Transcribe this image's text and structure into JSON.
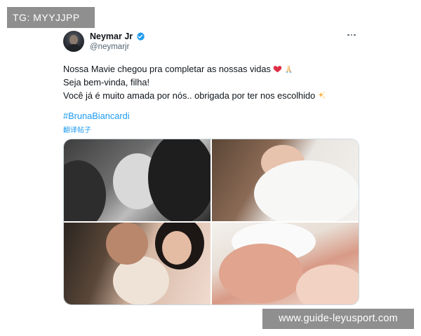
{
  "watermarks": {
    "top": "TG: MYYJJPP",
    "bottom": "www.guide-leyusport.com"
  },
  "tweet": {
    "author": {
      "name": "Neymar Jr",
      "handle": "@neymarjr",
      "verified": true
    },
    "lines": [
      "Nossa Mavie chegou pra completar as nossas vidas",
      "Seja bem-vinda, filha!",
      "Você já é muito amada por nós.. obrigada por ter nos escolhido"
    ],
    "emojis": [
      "red-heart",
      "folded-hands",
      "sparkles"
    ],
    "hashtag": "#BrunaBiancardi",
    "translate_label": "翻译帖子",
    "photo_count": 4
  },
  "colors": {
    "link": "#1d9bf0",
    "verified": "#1d9bf0",
    "secondary_text": "#536471",
    "watermark_bg": "#8f8f8f"
  }
}
